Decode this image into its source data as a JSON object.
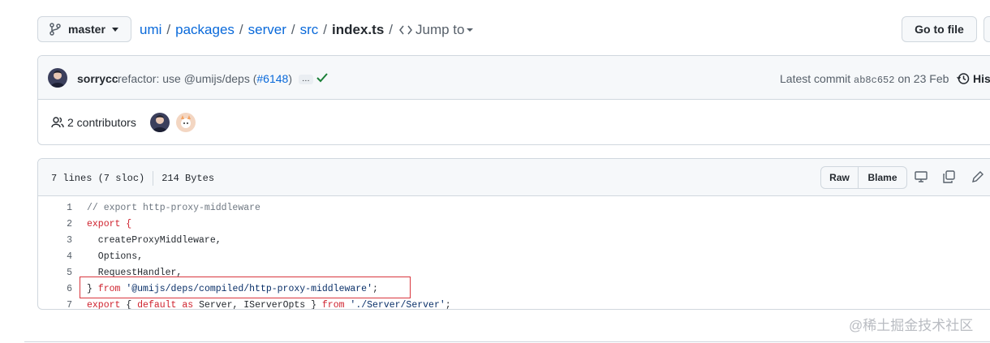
{
  "top_bar": {
    "branch": "master",
    "breadcrumb": [
      "umi",
      "packages",
      "server",
      "src"
    ],
    "file_name": "index.ts",
    "jump_to": "Jump to",
    "go_to_file": "Go to file"
  },
  "commit": {
    "author": "sorrycc",
    "message": "refactor: use @umijs/deps (",
    "pr": "#6148",
    "message_end": ")",
    "ellipsis": "…",
    "latest_label": "Latest commit",
    "sha": "ab8c652",
    "date_text": "on 23 Feb",
    "history": "History"
  },
  "contributors": {
    "count_label": "2 contributors"
  },
  "file": {
    "lines_info": "7 lines (7 sloc)",
    "size": "214 Bytes",
    "raw": "Raw",
    "blame": "Blame",
    "code": [
      {
        "n": "1",
        "text": "// export http-proxy-middleware"
      },
      {
        "n": "2",
        "text": "export {"
      },
      {
        "n": "3",
        "text": "  createProxyMiddleware,"
      },
      {
        "n": "4",
        "text": "  Options,"
      },
      {
        "n": "5",
        "text": "  RequestHandler,"
      },
      {
        "n": "6",
        "text": "} from '@umijs/deps/compiled/http-proxy-middleware';"
      },
      {
        "n": "7",
        "text": "export { default as Server, IServerOpts } from './Server/Server';"
      }
    ]
  },
  "watermark": "@稀土掘金技术社区",
  "colors": {
    "link": "#0969da",
    "highlight_border": "#d9363e",
    "success": "#1a7f37"
  }
}
